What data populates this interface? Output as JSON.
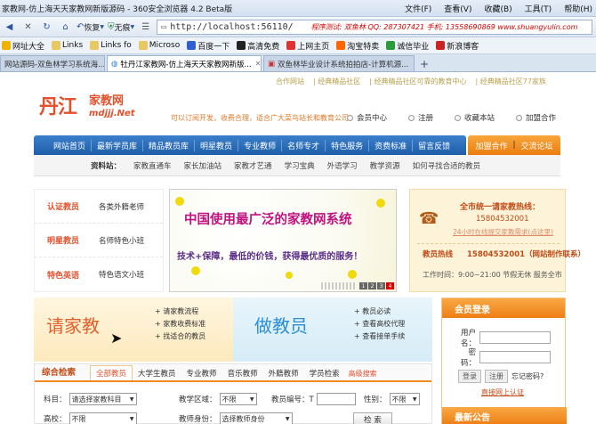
{
  "browser": {
    "window_title": "家教网-仿上海天天家教网新版源码 - 360安全浏览器 4.2 Beta版",
    "menus": [
      "文件(F)",
      "查看(V)",
      "收藏(B)",
      "工具(T)",
      "帮助(H)"
    ],
    "back_label": "后退",
    "forward_label": "恢复",
    "no_trace_label": "无痕",
    "address": "http://localhost:56110/",
    "promo": "程序测试: 双鱼林  QQ: 287307421  手机: 13558690869  www.shuangyulin.com",
    "favorites": [
      "网址大全",
      "Links",
      "Links fo",
      "Microso",
      "百度一下",
      "高清免费",
      "上网主页",
      "淘宝特卖",
      "诚信毕业",
      "新浪博客"
    ],
    "tabs": [
      {
        "label": "网站源码-双鱼林学习系统海...",
        "active": false
      },
      {
        "label": "牡丹江家教网-仿上海天天家教网新版...",
        "active": true
      },
      {
        "label": "双鱼林毕业设计系统拍拍店-计算机源...",
        "active": false
      }
    ]
  },
  "site": {
    "top_links": [
      "合作网站",
      "经典精品社区",
      "经典精品社区可靠的教育中心",
      "经典精品社区77家族"
    ],
    "logo_mark": "丹江",
    "logo_jj": "家教网",
    "logo_domain": "mdjjj.Net",
    "slogan": "可以订阅开发，收费合理，适合广大菜鸟站长和教育公司",
    "user_links": [
      "会员中心",
      "注册",
      "收藏本站",
      "加盟合作"
    ],
    "nav": [
      "网站首页",
      "最新学员库",
      "精品教员库",
      "明星教员",
      "专业教师",
      "名师专才",
      "特色服务",
      "资费标准",
      "留言反馈"
    ],
    "nav_right": [
      "加盟合作",
      "交流论坛"
    ],
    "subnav_lead": "资料站：",
    "subnav": [
      "家教直通车",
      "家长加油站",
      "家教才艺通",
      "学习宝典",
      "外语学习",
      "教学资源",
      "如何寻找合适的教员"
    ],
    "left_box": [
      {
        "key": "认证教员",
        "value": "各类外籍老师"
      },
      {
        "key": "明星教员",
        "value": "名师特色小班"
      },
      {
        "key": "特色英语",
        "value": "特色语文小班"
      }
    ],
    "banner": {
      "headline": "中国使用最广泛的家教网系统",
      "subline": "技术+保障，最低的价钱，获得最优质的服务！",
      "pages": [
        "1",
        "2",
        "3",
        "4"
      ]
    },
    "hotline": {
      "title": "全市统一请家教热线：",
      "number": "15804532001",
      "qq_link": "24小时在线提交家教需求(点这里)",
      "tutor_label": "教员热线",
      "tutor_number": "15804532001（网站制作联系）",
      "hours": "工作时间：9:00~21:00 节假无休 服务全市"
    },
    "qjj": {
      "title": "请家教",
      "items": [
        "请家教流程",
        "家教收费标准",
        "找适合的教员"
      ]
    },
    "zjy": {
      "title": "做教员",
      "items": [
        "教员必读",
        "查看高校代理",
        "查看接单手续"
      ]
    },
    "login": {
      "header": "会员登录",
      "user_label": "用户名：",
      "pass_label": "密　码：",
      "login_btn": "登录",
      "reg_btn": "注册",
      "forgot": "忘记密码?",
      "auth": "直接网上认证",
      "news_header": "最新公告"
    },
    "search": {
      "header": "综合检索",
      "tabs": [
        "全部教员",
        "大学生教员",
        "专业教师",
        "音乐教师",
        "外籍教师",
        "学员检索"
      ],
      "advanced": "高级搜索",
      "subject_label": "科目：",
      "subject_value": "请选择家教科目",
      "area_label": "教学区域：",
      "area_value": "不限",
      "no_label": "教员编号：T",
      "gender_label": "性别：",
      "gender_value": "不限",
      "school_label": "高校：",
      "school_value": "不限",
      "identity_label": "教师身份：",
      "identity_value": "选择教师身份",
      "search_btn": "检 索"
    }
  }
}
